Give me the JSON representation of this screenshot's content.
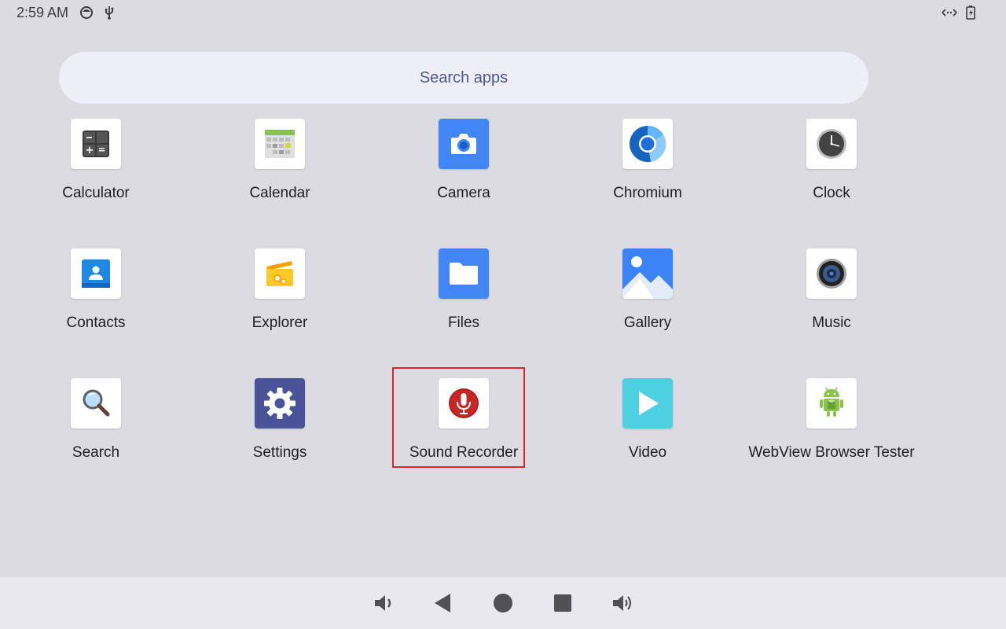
{
  "status_bar": {
    "time": "2:59 AM",
    "left_icons": [
      "face-icon",
      "usb-icon"
    ],
    "right_icons": [
      "data-transfer-icon",
      "battery-charging-icon"
    ]
  },
  "search": {
    "placeholder": "Search apps"
  },
  "apps": [
    {
      "label": "Calculator",
      "icon": "calculator-icon"
    },
    {
      "label": "Calendar",
      "icon": "calendar-icon"
    },
    {
      "label": "Camera",
      "icon": "camera-icon"
    },
    {
      "label": "Chromium",
      "icon": "chromium-icon"
    },
    {
      "label": "Clock",
      "icon": "clock-icon"
    },
    {
      "label": "Contacts",
      "icon": "contacts-icon"
    },
    {
      "label": "Explorer",
      "icon": "explorer-icon"
    },
    {
      "label": "Files",
      "icon": "folder-icon"
    },
    {
      "label": "Gallery",
      "icon": "gallery-icon"
    },
    {
      "label": "Music",
      "icon": "speaker-icon"
    },
    {
      "label": "Search",
      "icon": "magnifier-icon"
    },
    {
      "label": "Settings",
      "icon": "gear-icon"
    },
    {
      "label": "Sound Recorder",
      "icon": "microphone-icon",
      "highlighted": true
    },
    {
      "label": "Video",
      "icon": "play-icon"
    },
    {
      "label": "WebView Browser Tester",
      "icon": "android-icon"
    }
  ],
  "nav_bar": {
    "buttons": [
      "volume-down-icon",
      "back-icon",
      "home-icon",
      "recents-icon",
      "volume-up-icon"
    ]
  },
  "colors": {
    "background": "#dcdbe2",
    "search_bg": "#efeff9",
    "highlight": "#d9252b",
    "nav_bg": "#e9e8ee"
  }
}
